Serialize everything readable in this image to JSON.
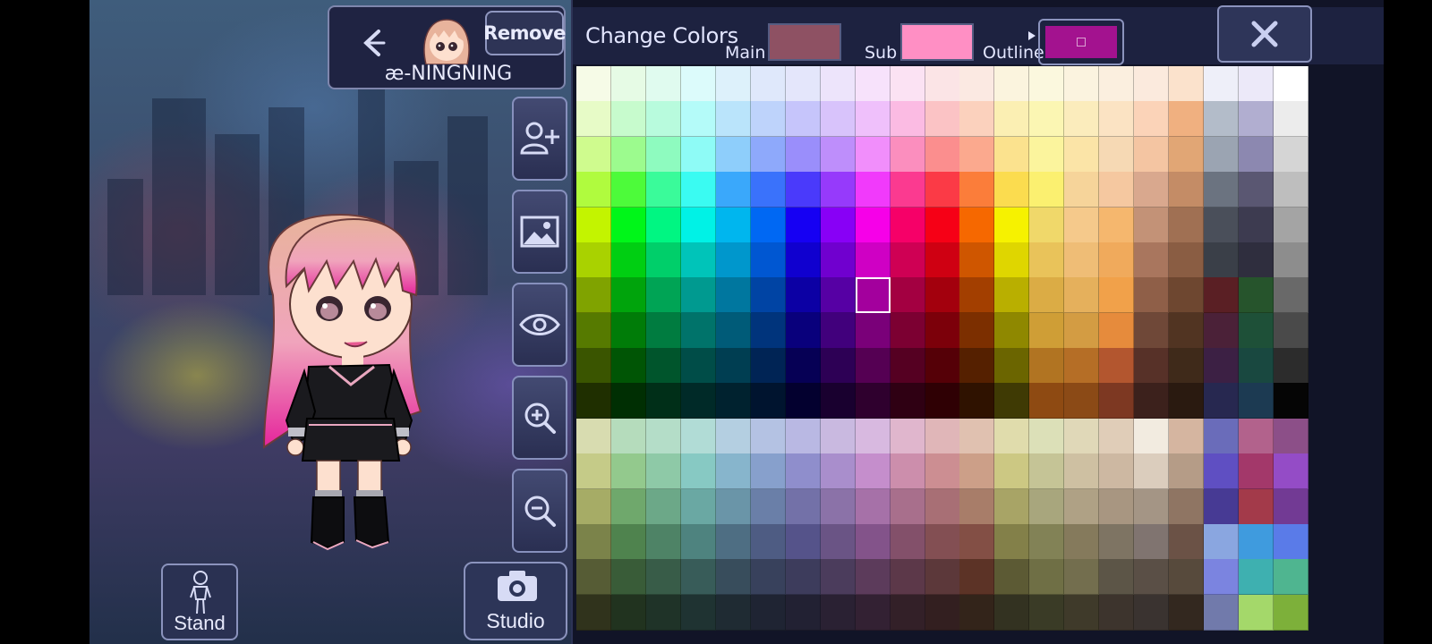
{
  "character": {
    "name": "æ-NINGNING",
    "remove_label": "Remove"
  },
  "bottom": {
    "stand_label": "Stand",
    "studio_label": "Studio"
  },
  "tools": [
    {
      "name": "add-character-button",
      "icon": "person-plus-icon"
    },
    {
      "name": "background-button",
      "icon": "image-icon"
    },
    {
      "name": "visibility-button",
      "icon": "eye-icon"
    },
    {
      "name": "zoom-in-button",
      "icon": "zoom-in-icon"
    },
    {
      "name": "zoom-out-button",
      "icon": "zoom-out-icon"
    }
  ],
  "color_panel": {
    "title": "Change Colors",
    "main_label": "Main",
    "sub_label": "Sub",
    "outline_label": "Outline",
    "main_color": "#8e5163",
    "sub_color": "#ff8fc4",
    "outline_color": "#a3128f",
    "selected_cell": [
      6,
      8
    ]
  },
  "palette": [
    [
      "#f6fbe7",
      "#e6fbe5",
      "#e0fbef",
      "#dcfbfb",
      "#ddf1fb",
      "#dfe8fb",
      "#e4e6fb",
      "#ede4fb",
      "#f7e2fb",
      "#fbe2f3",
      "#fbe4e6",
      "#fbe9e2",
      "#fbf4de",
      "#fbf8de",
      "#fbf3df",
      "#fbefdf",
      "#fbeadd",
      "#fbe2cc",
      "#eeeff9",
      "#ece9f9",
      "#ffffff"
    ],
    [
      "#e7fbc7",
      "#c7fbcd",
      "#b8fbdd",
      "#b4fbf9",
      "#bae4fb",
      "#bed3fb",
      "#c6c5fb",
      "#d8c3fb",
      "#efc0fb",
      "#fbbbe3",
      "#fbc3c5",
      "#fbd1bd",
      "#fbefb3",
      "#fbf6b3",
      "#fbecbc",
      "#fbe3c3",
      "#fbd3b8",
      "#f0b080",
      "#b3bcc9",
      "#b1aed0",
      "#ececec"
    ],
    [
      "#cffb8e",
      "#9cfb8e",
      "#8efbbf",
      "#8efbf6",
      "#8ecefb",
      "#8ea9fb",
      "#9a8efb",
      "#be8efb",
      "#f18efb",
      "#fb8ebe",
      "#fb8e8e",
      "#fba98e",
      "#fbe28e",
      "#fbf49d",
      "#fbe4a7",
      "#f6d9b4",
      "#f4c5a2",
      "#e1a675",
      "#9ba4b2",
      "#8c88b0",
      "#d5d5d5"
    ],
    [
      "#b0fb3e",
      "#4dfb3a",
      "#3afb9a",
      "#3afbf2",
      "#3aa8fb",
      "#3a72fb",
      "#4a3afb",
      "#963afb",
      "#f13afb",
      "#fb3a90",
      "#fb3a46",
      "#fb7d3a",
      "#fbdc4f",
      "#fbf070",
      "#f6d49a",
      "#f5c8a0",
      "#d9a88e",
      "#c48c66",
      "#6b7380",
      "#5a5772",
      "#bebebe"
    ],
    [
      "#c3f400",
      "#00f619",
      "#00f682",
      "#00f2e6",
      "#00b6ee",
      "#0068f3",
      "#1600f3",
      "#8800f6",
      "#f600e8",
      "#f60068",
      "#f60016",
      "#f66800",
      "#f6f200",
      "#f0d86a",
      "#f5c98b",
      "#f5b76e",
      "#c39277",
      "#a07053",
      "#4a4f5a",
      "#3d3b50",
      "#a4a4a4"
    ],
    [
      "#a9d200",
      "#00cf12",
      "#00cf6a",
      "#00c4b9",
      "#0097cc",
      "#0057d2",
      "#1000cf",
      "#7000cf",
      "#cf00c4",
      "#cf0054",
      "#cf0012",
      "#cf5600",
      "#dfd600",
      "#e9c35a",
      "#efbd76",
      "#f0aa5c",
      "#a9765e",
      "#8a5d43",
      "#3a3f48",
      "#2f2e3e",
      "#8d8d8d"
    ],
    [
      "#80a300",
      "#00a40c",
      "#00a455",
      "#009a90",
      "#00779f",
      "#0044a4",
      "#0c00a4",
      "#5600a4",
      "#a3009d",
      "#a30041",
      "#a3000d",
      "#a33f00",
      "#b9af00",
      "#dbac45",
      "#e5b05c",
      "#f1a14a",
      "#8f5f48",
      "#6e4730",
      "#5a1f24",
      "#26542c",
      "#696969"
    ],
    [
      "#567a00",
      "#007c08",
      "#007c40",
      "#00736a",
      "#005b78",
      "#00347c",
      "#09007c",
      "#41007c",
      "#7a0079",
      "#7c0032",
      "#7c000a",
      "#7c2f00",
      "#8f8800",
      "#cf9e36",
      "#d39c43",
      "#e68b3c",
      "#6f4838",
      "#513422",
      "#4b2138",
      "#1e5038",
      "#4a4a4a"
    ],
    [
      "#3a5500",
      "#005505",
      "#00552c",
      "#004d48",
      "#003e52",
      "#002455",
      "#060055",
      "#2d0055",
      "#550053",
      "#550022",
      "#550007",
      "#552000",
      "#6b6500",
      "#b17422",
      "#b56e26",
      "#b3562f",
      "#573128",
      "#3f2a1a",
      "#3c2044",
      "#194840",
      "#2c2c2c"
    ],
    [
      "#1f2f00",
      "#002f03",
      "#002f18",
      "#002a28",
      "#00222f",
      "#00142f",
      "#03002f",
      "#19002f",
      "#2f002e",
      "#2f0013",
      "#2f0004",
      "#2f1200",
      "#3f3a04",
      "#8e4a12",
      "#8b4a16",
      "#7d3822",
      "#3c211c",
      "#2a1a10",
      "#272850",
      "#1c3a52",
      "#050505"
    ],
    [
      "#d8dcb0",
      "#b5dcbc",
      "#b4ddc8",
      "#b1dcd6",
      "#b4cfe1",
      "#b4c2e3",
      "#b9b8e3",
      "#c9b9e0",
      "#d8b9e0",
      "#e0b6cd",
      "#e0b6b8",
      "#e0c1b0",
      "#e0dcac",
      "#dce0b8",
      "#e0d8b8",
      "#e0cdb8",
      "#f2ebe0",
      "#d5b5a0",
      "#6a6cba",
      "#b2628c",
      "#8c4f88"
    ],
    [
      "#c5cb88",
      "#93c98d",
      "#8ec9a7",
      "#87c9c3",
      "#87b5cc",
      "#87a0cc",
      "#8f8ecc",
      "#a98ecc",
      "#c58ecc",
      "#cc8eac",
      "#cc8e92",
      "#cc9f88",
      "#ccc883",
      "#c5c496",
      "#cec0a2",
      "#cdb8a2",
      "#dbcdbd",
      "#b59c87",
      "#5f4fc2",
      "#a3386a",
      "#944cc6"
    ],
    [
      "#a6ac66",
      "#6fa86c",
      "#6ca888",
      "#6aa8a3",
      "#6a95a8",
      "#6a7fa8",
      "#7371a8",
      "#8b72a8",
      "#a671a8",
      "#a86f8c",
      "#a86f75",
      "#a87d69",
      "#a8a466",
      "#a8a67d",
      "#afa185",
      "#a89681",
      "#a49585",
      "#8f7563",
      "#473a94",
      "#a33a4a",
      "#723a94"
    ],
    [
      "#7b834a",
      "#4f834e",
      "#4e8366",
      "#4e837f",
      "#4e6e83",
      "#4e5c83",
      "#55538a",
      "#6a5485",
      "#83538a",
      "#83506a",
      "#834f53",
      "#834f45",
      "#838049",
      "#828256",
      "#857a5c",
      "#7e7463",
      "#807470",
      "#6b5246",
      "#8aa6e0",
      "#3f9bde",
      "#5a7be8"
    ],
    [
      "#565c35",
      "#395c38",
      "#385c48",
      "#385c59",
      "#384d5c",
      "#38415c",
      "#3d3c5c",
      "#4b3c5c",
      "#5c3b5b",
      "#5c3849",
      "#5c383a",
      "#5c3326",
      "#5c5a34",
      "#6f6f45",
      "#736e4e",
      "#5c5547",
      "#5a4f46",
      "#574a3c",
      "#7b84e0",
      "#3eb0b0",
      "#4fb590"
    ],
    [
      "#30331c",
      "#21331f",
      "#1f3328",
      "#1f3332",
      "#1f2b33",
      "#1f2433",
      "#222133",
      "#2a2133",
      "#332133",
      "#332028",
      "#331f20",
      "#33241a",
      "#333221",
      "#3a3b26",
      "#3f3a2a",
      "#3d342d",
      "#3a3330",
      "#33281f",
      "#717aab",
      "#a4d86a",
      "#7db03a"
    ]
  ]
}
